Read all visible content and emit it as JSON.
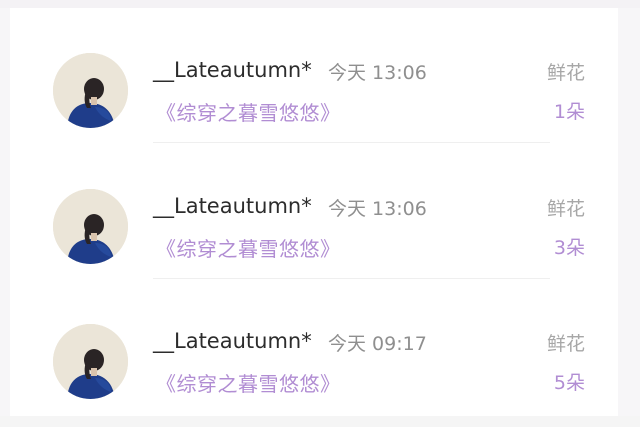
{
  "records": [
    {
      "username": "__Lateautumn*",
      "time": "今天 13:06",
      "book": "《综穿之暮雪悠悠》",
      "gift_label": "鲜花",
      "gift_count": "1朵",
      "avatar_icon": "avatar-girl-blue-sweater-icon"
    },
    {
      "username": "__Lateautumn*",
      "time": "今天 13:06",
      "book": "《综穿之暮雪悠悠》",
      "gift_label": "鲜花",
      "gift_count": "3朵",
      "avatar_icon": "avatar-girl-blue-sweater-icon"
    },
    {
      "username": "__Lateautumn*",
      "time": "今天 09:17",
      "book": "《综穿之暮雪悠悠》",
      "gift_label": "鲜花",
      "gift_count": "5朵",
      "avatar_icon": "avatar-girl-blue-sweater-icon"
    }
  ],
  "colors": {
    "accent_purple": "#b18dd3",
    "avatar_background": "#ebe5d8",
    "sweater_blue": "#1f3d8a"
  }
}
